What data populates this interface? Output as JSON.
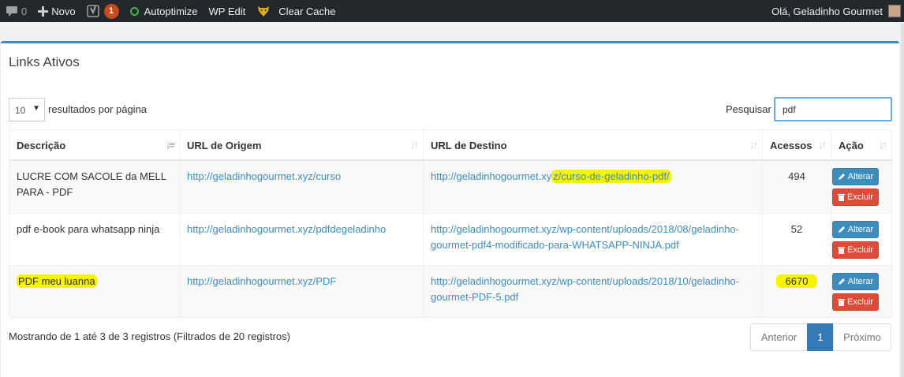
{
  "adminbar": {
    "comments_count": "0",
    "new_label": "Novo",
    "yoast_badge": "1",
    "autoptimize_label": "Autoptimize",
    "wpedit_label": "WP Edit",
    "clearcache_label": "Clear Cache",
    "greeting": "Olá, Geladinho Gourmet"
  },
  "panel": {
    "title": "Links Ativos"
  },
  "length": {
    "selected": "10",
    "label": "resultados por página"
  },
  "search": {
    "label": "Pesquisar",
    "value": "pdf"
  },
  "table": {
    "headers": [
      "Descrição",
      "URL de Origem",
      "URL de Destino",
      "Acessos",
      "Ação"
    ],
    "rows": [
      {
        "desc": "LUCRE COM SACOLE da MELL PARA - PDF",
        "origin": "http://geladinhogourmet.xyz/curso",
        "dest_a": "http://geladinhogourmet.xy",
        "dest_b": "z/curso-de-geladinho-pdf/",
        "hits": "494"
      },
      {
        "desc": "pdf e-book para whatsapp ninja",
        "origin": "http://geladinhogourmet.xyz/pdfdegeladinho",
        "dest": "http://geladinhogourmet.xyz/wp-content/uploads/2018/08/geladinho-gourmet-pdf4-modificado-para-WHATSAPP-NINJA.pdf",
        "hits": "52"
      },
      {
        "desc": "PDF meu luanna",
        "origin": "http://geladinhogourmet.xyz/PDF",
        "dest": "http://geladinhogourmet.xyz/wp-content/uploads/2018/10/geladinho-gourmet-PDF-5.pdf",
        "hits": "6670"
      }
    ],
    "edit_label": "Alterar",
    "delete_label": "Excluir"
  },
  "info": "Mostrando de 1 até 3 de 3 registros (Filtrados de 20 registros)",
  "pagination": {
    "prev": "Anterior",
    "current": "1",
    "next": "Próximo"
  },
  "colors": {
    "adminbar": "#23282d",
    "accent": "#3c8dbc",
    "danger": "#dd4b39",
    "highlight": "#f7f400"
  }
}
